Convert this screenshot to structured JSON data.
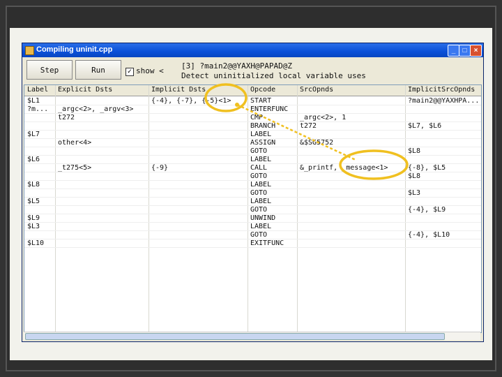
{
  "window": {
    "title": "Compiling uninit.cpp"
  },
  "toolbar": {
    "step_label": "Step",
    "run_label": "Run",
    "show_label": "show <",
    "show_checked": true,
    "info_line1": "[3] ?main2@@YAXH@PAPAD@Z",
    "info_line2": "Detect uninitialized local variable uses"
  },
  "table": {
    "columns": [
      "Label",
      "Explicit Dsts",
      "Implicit Dsts",
      "Opcode",
      "SrcOpnds",
      "ImplicitSrcOpnds"
    ],
    "rows": [
      [
        "$L1",
        "",
        "{-4}, {-7}, {-5}<1>",
        "START",
        "",
        "?main2@@YAXHPA..."
      ],
      [
        "?m...",
        "_argc<2>, _argv<3>",
        "",
        "ENTERFUNC",
        "",
        ""
      ],
      [
        "",
        "t272",
        "",
        "CMP",
        "_argc<2>, 1",
        ""
      ],
      [
        "",
        "",
        "",
        "BRANCH",
        "t272",
        "$L7, $L6"
      ],
      [
        "$L7",
        "",
        "",
        "LABEL",
        "",
        ""
      ],
      [
        "",
        "other<4>",
        "",
        "ASSIGN",
        "&$SG5752",
        ""
      ],
      [
        "",
        "",
        "",
        "GOTO",
        "",
        "$L8"
      ],
      [
        "$L6",
        "",
        "",
        "LABEL",
        "",
        ""
      ],
      [
        "",
        "_t275<5>",
        "{-9}",
        "CALL",
        "&_printf, _message<1>",
        "{-8}, $L5"
      ],
      [
        "",
        "",
        "",
        "GOTO",
        "",
        "$L8"
      ],
      [
        "$L8",
        "",
        "",
        "LABEL",
        "",
        ""
      ],
      [
        "",
        "",
        "",
        "GOTO",
        "",
        "$L3"
      ],
      [
        "$L5",
        "",
        "",
        "LABEL",
        "",
        ""
      ],
      [
        "",
        "",
        "",
        "GOTO",
        "",
        "{-4}, $L9"
      ],
      [
        "$L9",
        "",
        "",
        "UNWIND",
        "",
        ""
      ],
      [
        "$L3",
        "",
        "",
        "LABEL",
        "",
        ""
      ],
      [
        "",
        "",
        "",
        "GOTO",
        "",
        "{-4}, $L10"
      ],
      [
        "$L10",
        "",
        "",
        "EXITFUNC",
        "",
        ""
      ]
    ]
  },
  "colors": {
    "highlight": "#f0c020",
    "titlebar": "#0a50d8"
  },
  "icons": [
    "app-icon",
    "minimize-icon",
    "maximize-icon",
    "close-icon"
  ]
}
